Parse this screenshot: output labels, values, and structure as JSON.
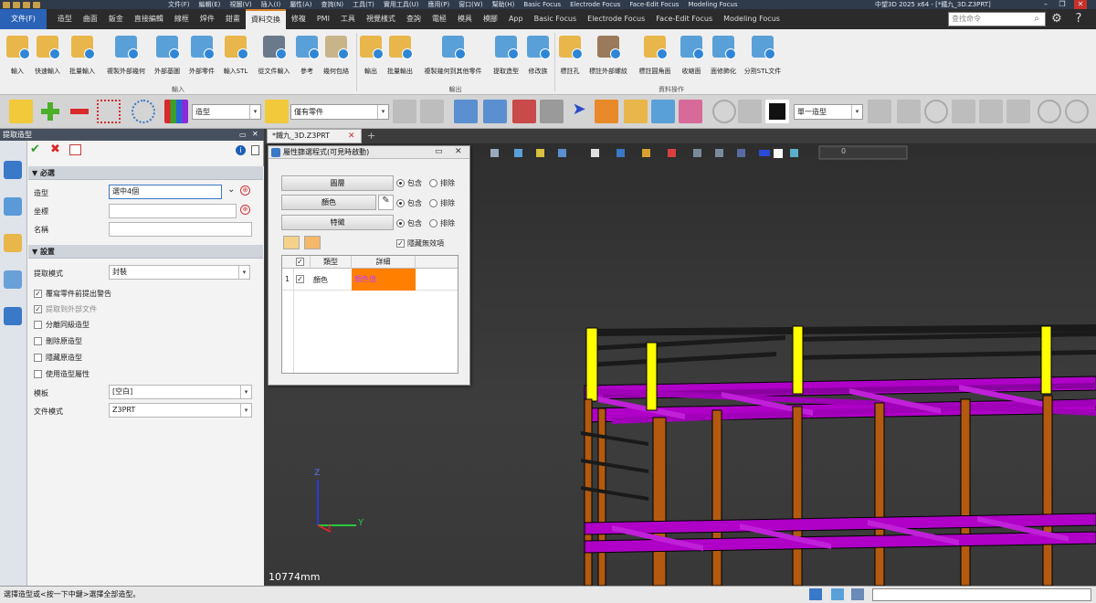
{
  "app": {
    "title": "中望3D 2025 x64 - [*鐵九_3D.Z3PRT]",
    "top_menus": [
      "文件(F)",
      "編輯(E)",
      "視圖(V)",
      "插入(I)",
      "屬性(A)",
      "查詢(N)",
      "工具(T)",
      "實用工具(U)",
      "應用(P)",
      "窗口(W)",
      "幫助(H)",
      "Basic Focus",
      "Electrode Focus",
      "Face-Edit Focus",
      "Modeling Focus"
    ]
  },
  "ribbon_tabs": {
    "file": "文件(F)",
    "tabs": [
      "造型",
      "曲面",
      "鈑金",
      "直接編輯",
      "線框",
      "焊件",
      "鉗畫",
      "資料交換",
      "修複",
      "PMI",
      "工具",
      "視覺樣式",
      "查詢",
      "電極",
      "模具",
      "模腳",
      "App",
      "Basic Focus",
      "Electrode Focus",
      "Face-Edit Focus",
      "Modeling Focus"
    ],
    "active": "資料交換"
  },
  "command_search": {
    "placeholder": "查找命令"
  },
  "ribbon": {
    "buttons": [
      "輸入",
      "快速輸入",
      "批量輸入",
      "複製外部幾何",
      "外部基圖",
      "外部零件",
      "輸入STL",
      "從文件輸入",
      "參考",
      "幾何包絡",
      "輸出",
      "批量輸出",
      "複製幾何到其他零件",
      "提取造型",
      "修改族",
      "標註孔",
      "標註外部螺紋",
      "標註圓角面",
      "收縮面",
      "面修飾化",
      "分割STL文件"
    ],
    "groups": [
      "輸入",
      "輸出",
      "資料操作"
    ]
  },
  "toolbar": {
    "select1": "造型",
    "select2": "僅有零件",
    "select3": "單一造型"
  },
  "left_panel": {
    "title": "提取造型",
    "section_required": "必選",
    "field_shape_label": "造型",
    "field_shape_value": "選中4個",
    "field_coord_label": "坐標",
    "field_name_label": "名稱",
    "section_settings": "設置",
    "extract_mode_label": "提取模式",
    "extract_mode_value": "封裝",
    "checkboxes": [
      {
        "label": "覆寫零件前提出警告",
        "checked": true,
        "disabled": false
      },
      {
        "label": "提取到外部文件",
        "checked": true,
        "disabled": true
      },
      {
        "label": "分離同級造型",
        "checked": false,
        "disabled": false
      },
      {
        "label": "刪除原造型",
        "checked": false,
        "disabled": false
      },
      {
        "label": "隱藏原造型",
        "checked": false,
        "disabled": false
      },
      {
        "label": "使用造型屬性",
        "checked": false,
        "disabled": false
      }
    ],
    "template_label": "模板",
    "template_value": "[空白]",
    "file_mode_label": "文件模式",
    "file_mode_value": "Z3PRT"
  },
  "doc_tab": {
    "label": "*鐵九_3D.Z3PRT"
  },
  "filter_dialog": {
    "title": "屬性篩選程式(可見時啟動)",
    "rows": [
      {
        "button": "圖層",
        "include": "包含",
        "exclude": "排除"
      },
      {
        "button": "顏色",
        "include": "包含",
        "exclude": "排除"
      },
      {
        "button": "特徵",
        "include": "包含",
        "exclude": "排除"
      }
    ],
    "hide_empty_label": "隱藏無效項",
    "table_headers": [
      "類型",
      "詳細"
    ],
    "table_row": {
      "index": "1",
      "type": "顏色",
      "detail": "顏色值"
    },
    "detail_color": "#ff7f00"
  },
  "viewport": {
    "dimension": "10774mm",
    "axis_y": "Y",
    "axis_z": "Z",
    "axis_x": "X",
    "render_mode": "0"
  },
  "statusbar": {
    "text": "選擇造型或<按一下中鍵>選擇全部造型。"
  },
  "colors": {
    "accent": "#2a62b8",
    "beam": "#b000c8",
    "column": "#b35a10",
    "post": "#ffff00"
  }
}
